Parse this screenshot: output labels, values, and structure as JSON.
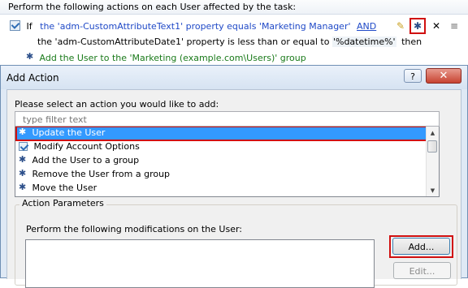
{
  "task": {
    "header": "Perform the following actions on each User affected by the task:",
    "if_keyword": "If",
    "condition1": "the 'adm-CustomAttributeText1' property equals 'Marketing Manager'",
    "and_link": "AND",
    "condition2_prefix": "the 'adm-CustomAttributeDate1' property is less than or equal to",
    "condition2_value": "'%datetime%'",
    "then_keyword": "then",
    "action": "Add the User to the 'Marketing (example.com\\Users)' group"
  },
  "dialog": {
    "title": "Add Action",
    "help_button": "?",
    "close_button": "✕",
    "select_prompt": "Please select an action you would like to add:",
    "filter_placeholder": "type filter text",
    "actions": [
      {
        "label": "Update the User",
        "selected": true,
        "icon": "gear-icon"
      },
      {
        "label": "Modify Account Options",
        "selected": false,
        "icon": "account-options-icon"
      },
      {
        "label": "Add the User to a group",
        "selected": false,
        "icon": "gear-icon"
      },
      {
        "label": "Remove the User from a group",
        "selected": false,
        "icon": "gear-icon"
      },
      {
        "label": "Move the User",
        "selected": false,
        "icon": "gear-icon"
      }
    ],
    "params_title": "Action Parameters",
    "mods_label": "Perform the following modifications on the User:",
    "add_button": "Add...",
    "edit_button": "Edit..."
  },
  "colors": {
    "selection": "#3399ff",
    "highlight_red": "#d01010",
    "link_blue": "#1f49c7",
    "action_green": "#1a7a1a"
  }
}
